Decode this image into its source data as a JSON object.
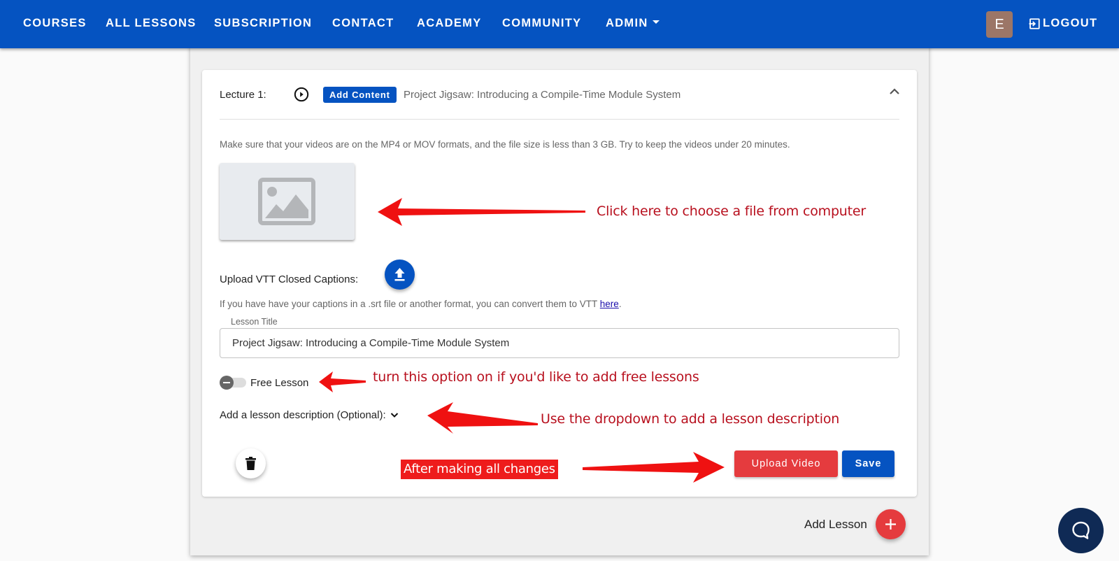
{
  "nav": {
    "items": [
      "COURSES",
      "ALL LESSONS",
      "SUBSCRIPTION",
      "CONTACT",
      "ACADEMY",
      "COMMUNITY",
      "ADMIN"
    ],
    "admin_has_dropdown": true,
    "avatar_initial": "E",
    "logout_label": "LOGOUT",
    "brand_color": "#0553c1"
  },
  "lecture": {
    "label": "Lecture 1:",
    "add_content_label": "Add Content",
    "title": "Project Jigsaw: Introducing a Compile-Time Module System",
    "expanded": true
  },
  "upload": {
    "hint": "Make sure that your videos are on the MP4 or MOV formats, and the file size is less than 3 GB. Try to keep the videos under 20 minutes.",
    "thumbnail_icon": "image-placeholder-icon",
    "vtt_label": "Upload VTT Closed Captions:",
    "caption_help_prefix": "If you have have your captions in a .srt file or another format, you can convert them to VTT ",
    "caption_help_link": "here",
    "caption_help_suffix": "."
  },
  "form": {
    "lesson_title_label": "Lesson Title",
    "lesson_title_value": "Project Jigsaw: Introducing a Compile-Time Module System",
    "free_lesson_label": "Free Lesson",
    "free_lesson_on": false,
    "description_toggle_label": "Add a lesson description (Optional):"
  },
  "actions": {
    "upload_video_label": "Upload Video",
    "save_label": "Save",
    "add_lesson_label": "Add Lesson",
    "upload_color": "#e53b3e",
    "save_color": "#0553c1"
  },
  "annotations": {
    "choose_file": "Click here to choose a file from computer",
    "free_lesson": "turn this option on if you'd like to add free lessons",
    "description": "Use the dropdown to add a lesson description",
    "after_changes": "After making all changes",
    "color": "#b8101e"
  }
}
